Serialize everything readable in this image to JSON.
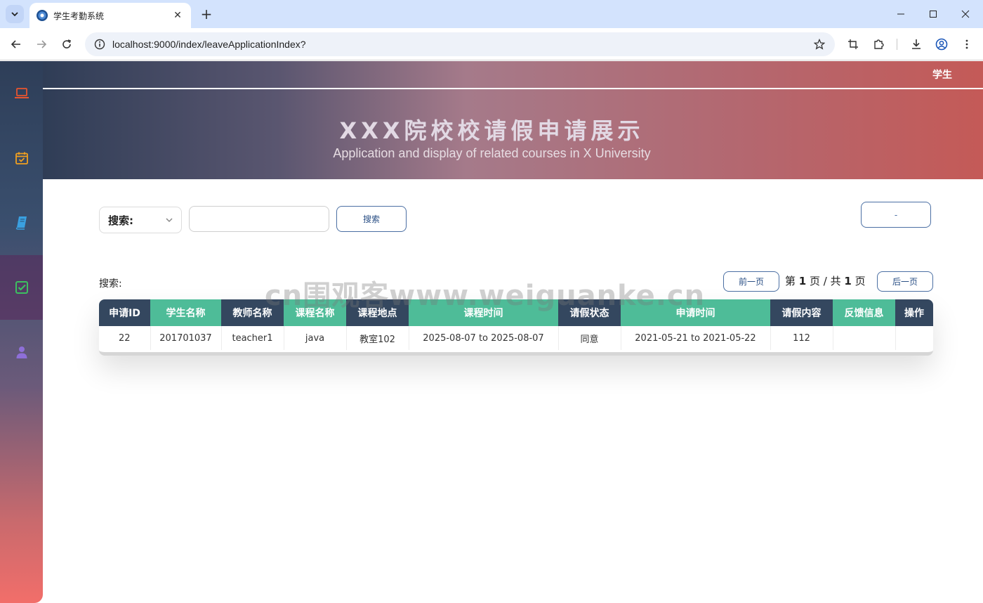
{
  "browser": {
    "tab_title": "学生考勤系统",
    "url": "localhost:9000/index/leaveApplicationIndex?"
  },
  "header": {
    "user_label": "学生",
    "title": "XXX院校校请假申请展示",
    "subtitle": "Application and display of related courses in X University"
  },
  "sidebar": {
    "items": [
      {
        "icon": "laptop-icon",
        "color": "#e8542f"
      },
      {
        "icon": "calendar-check-icon",
        "color": "#f0a020"
      },
      {
        "icon": "book-icon",
        "color": "#3aa0e0"
      },
      {
        "icon": "check-square-icon",
        "color": "#3cc060"
      },
      {
        "icon": "user-icon",
        "color": "#8e6fd8"
      }
    ]
  },
  "search": {
    "select_value": "搜索:",
    "input_value": "",
    "button_label": "搜索",
    "right_button_label": "-"
  },
  "pagination": {
    "label": "搜索:",
    "prev_label": "前一页",
    "page_prefix": "第",
    "current_page": "1",
    "page_mid": "页 / 共",
    "total_pages": "1",
    "page_suffix": "页",
    "next_label": "后一页"
  },
  "watermark": "cn围观客www.weiguanke.cn",
  "table": {
    "columns": [
      "申请ID",
      "学生名称",
      "教师名称",
      "课程名称",
      "课程地点",
      "课程时间",
      "请假状态",
      "申请时间",
      "请假内容",
      "反馈信息",
      "操作"
    ],
    "rows": [
      [
        "22",
        "201701037",
        "teacher1",
        "java",
        "教室102",
        "2025-08-07 to 2025-08-07",
        "同意",
        "2021-05-21 to 2021-05-22",
        "112",
        "",
        ""
      ]
    ]
  },
  "colors": {
    "header_dark": "#34475f",
    "header_green": "#4ebc98",
    "button_border": "#4b6fa3"
  }
}
